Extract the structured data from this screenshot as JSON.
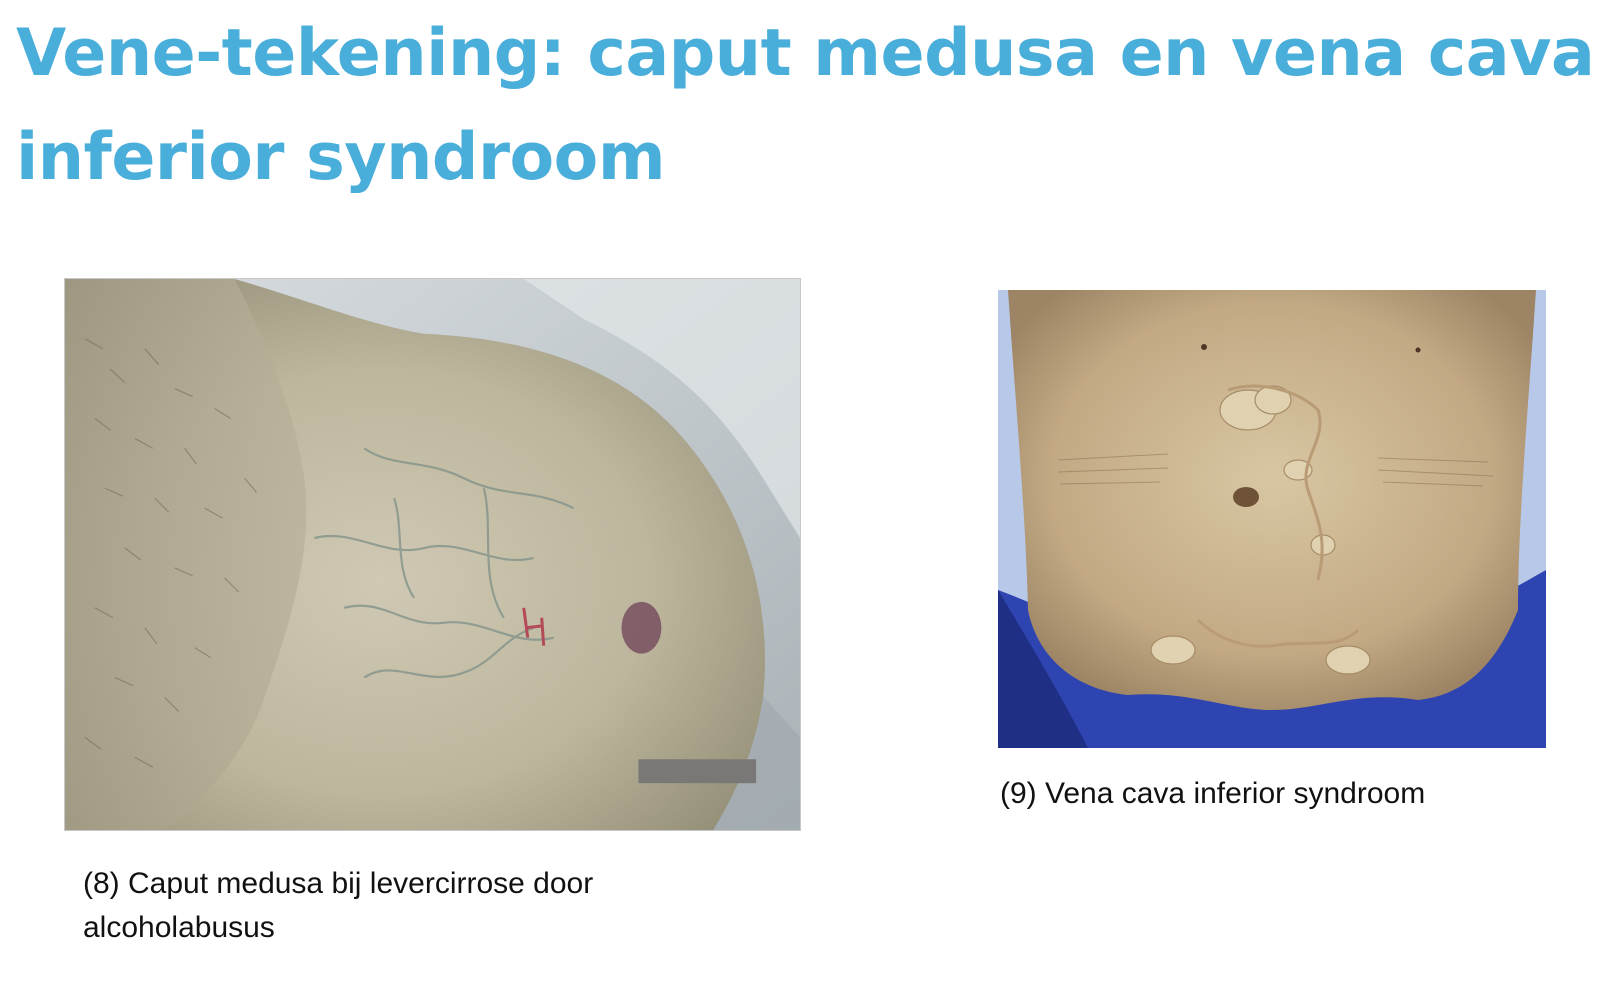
{
  "slide": {
    "title": "Vene-tekening: caput medusa en vena cava inferior syndroom"
  },
  "figures": [
    {
      "caption": "(8) Caput medusa bij levercirrose door alcoholabusus"
    },
    {
      "caption": "(9) Vena cava inferior syndroom"
    }
  ],
  "colors": {
    "title": "#4aaedb",
    "caption_text": "#111111",
    "background": "#ffffff"
  }
}
